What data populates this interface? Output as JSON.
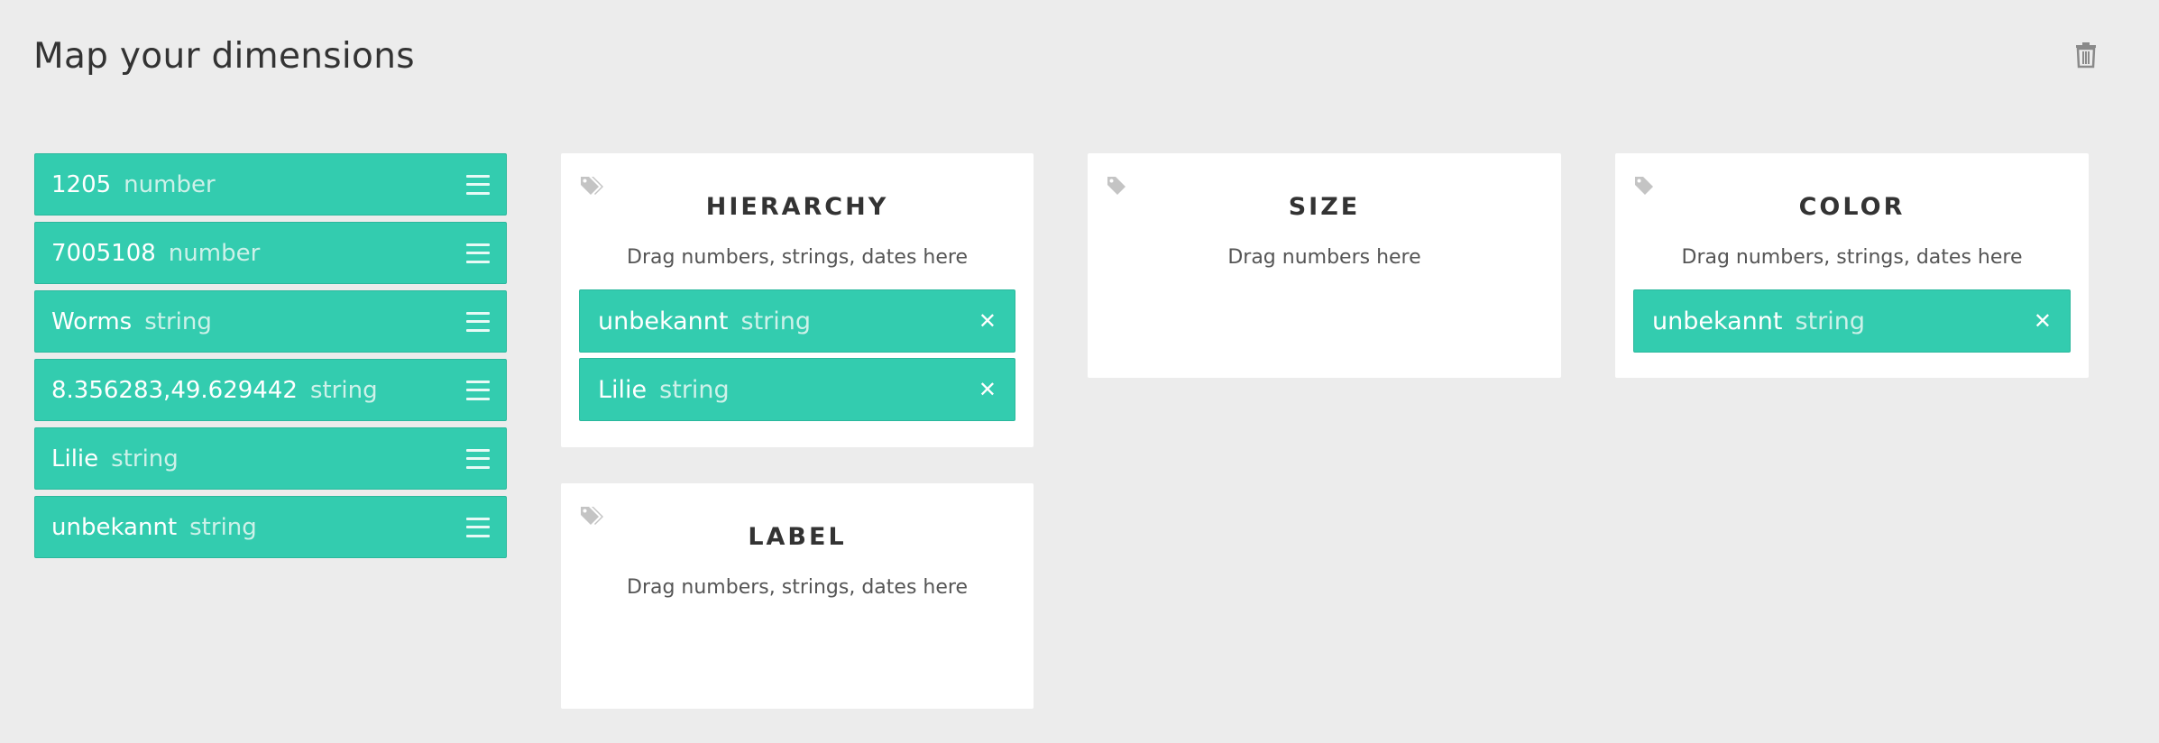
{
  "header": {
    "title": "Map your dimensions",
    "trash_icon": "trash-icon"
  },
  "dimensions": [
    {
      "name": "1205",
      "type": "number"
    },
    {
      "name": "7005108",
      "type": "number"
    },
    {
      "name": "Worms",
      "type": "string"
    },
    {
      "name": "8.356283,49.629442",
      "type": "string"
    },
    {
      "name": "Lilie",
      "type": "string"
    },
    {
      "name": "unbekannt",
      "type": "string"
    }
  ],
  "cards": {
    "hierarchy": {
      "title": "HIERARCHY",
      "hint": "Drag numbers, strings, dates here",
      "chips": [
        {
          "name": "unbekannt",
          "type": "string"
        },
        {
          "name": "Lilie",
          "type": "string"
        }
      ]
    },
    "size": {
      "title": "SIZE",
      "hint": "Drag numbers here",
      "chips": []
    },
    "color": {
      "title": "COLOR",
      "hint": "Drag numbers, strings, dates here",
      "chips": [
        {
          "name": "unbekannt",
          "type": "string"
        }
      ]
    },
    "label": {
      "title": "LABEL",
      "hint": "Drag numbers, strings, dates here",
      "chips": []
    }
  },
  "colors": {
    "accent": "#33ccaf",
    "background": "#ececec"
  },
  "icons": {
    "card_tag": "tags-icon",
    "chip_remove": "close-icon",
    "drag_handle": "drag-handle-icon"
  }
}
